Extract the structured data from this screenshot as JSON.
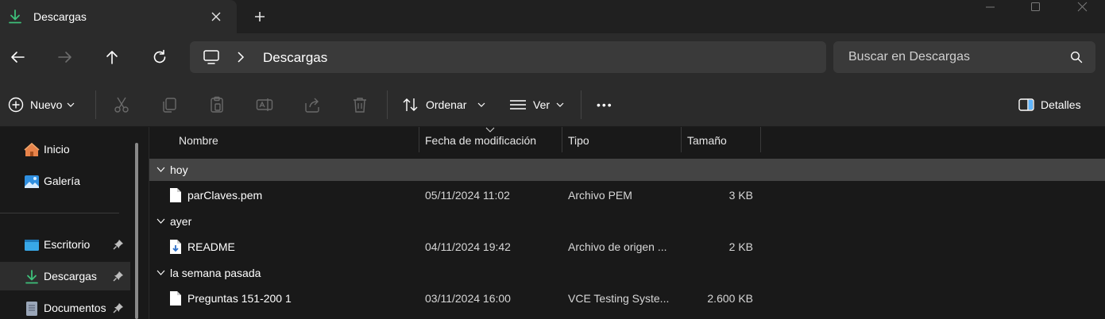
{
  "tab": {
    "title": "Descargas",
    "icon": "download-icon"
  },
  "address": {
    "location_icon": "computer-icon",
    "crumb": "Descargas"
  },
  "search": {
    "placeholder": "Buscar en Descargas"
  },
  "toolbar": {
    "new_label": "Nuevo",
    "sort_label": "Ordenar",
    "view_label": "Ver",
    "more_label": "•••",
    "details_label": "Detalles"
  },
  "sidebar": {
    "items": [
      {
        "label": "Inicio",
        "icon": "home-icon",
        "pinned": false
      },
      {
        "label": "Galería",
        "icon": "gallery-icon",
        "pinned": false
      },
      {
        "label": "Escritorio",
        "icon": "desktop-icon",
        "pinned": true
      },
      {
        "label": "Descargas",
        "icon": "download-icon",
        "pinned": true,
        "active": true
      },
      {
        "label": "Documentos",
        "icon": "documents-icon",
        "pinned": true
      }
    ]
  },
  "columns": {
    "name": "Nombre",
    "modified": "Fecha de modificación",
    "type": "Tipo",
    "size": "Tamaño"
  },
  "groups": [
    {
      "label": "hoy",
      "files": [
        {
          "name": "parClaves.pem",
          "modified": "05/11/2024 11:02",
          "type": "Archivo PEM",
          "size": "3 KB",
          "icon": "file-icon"
        }
      ]
    },
    {
      "label": "ayer",
      "files": [
        {
          "name": "README",
          "modified": "04/11/2024 19:42",
          "type": "Archivo de origen ...",
          "size": "2 KB",
          "icon": "source-file-icon"
        }
      ]
    },
    {
      "label": "la semana pasada",
      "files": [
        {
          "name": "Preguntas 151-200 1",
          "modified": "03/11/2024 16:00",
          "type": "VCE Testing Syste...",
          "size": "2.600 KB",
          "icon": "file-icon"
        }
      ]
    }
  ],
  "colors": {
    "accent": "#3ec07a",
    "background": "#191919",
    "chrome": "#2b2b2b",
    "selected_group": "#444444"
  }
}
